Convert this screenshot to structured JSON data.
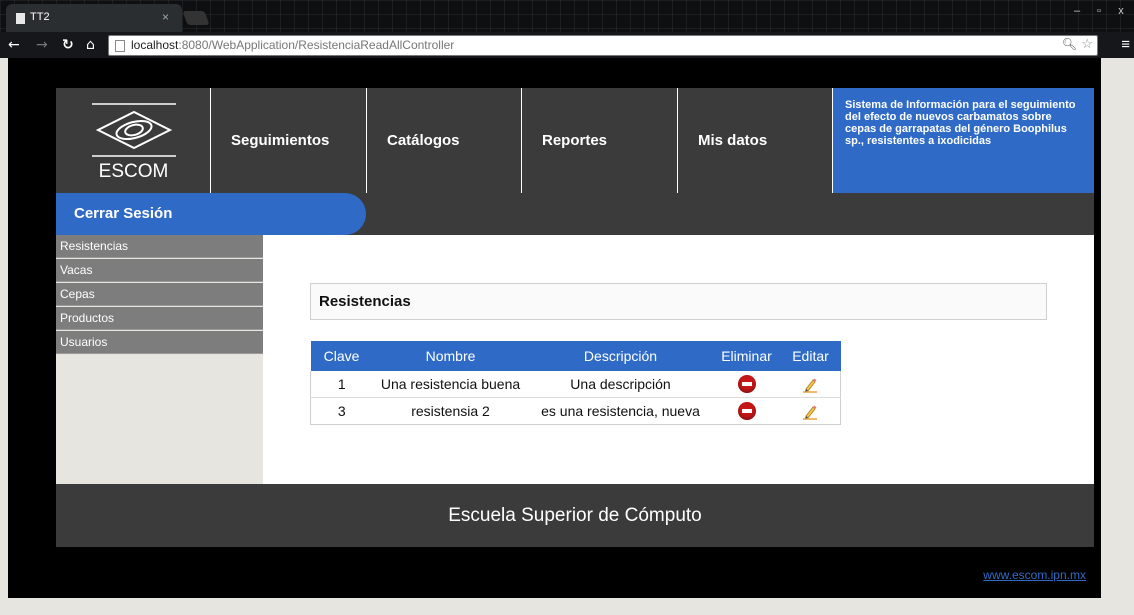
{
  "browser": {
    "tab_title": "TT2",
    "tab_close": "×",
    "url_host": "localhost",
    "url_rest": ":8080/WebApplication/ResistenciaReadAllController",
    "window_buttons": [
      "–",
      "▫",
      "x"
    ]
  },
  "header": {
    "logo_text": "ESCOM",
    "nav": [
      "Seguimientos",
      "Catálogos",
      "Reportes",
      "Mis datos"
    ],
    "system_info": "Sistema de Información para el seguimiento del efecto de nuevos carbamatos sobre cepas de garrapatas del género Boophilus sp., resistentes a ixodicidas"
  },
  "session": {
    "logout_label": "Cerrar Sesión"
  },
  "sidebar": {
    "items": [
      "Resistencias",
      "Vacas",
      "Cepas",
      "Productos",
      "Usuarios"
    ]
  },
  "main": {
    "panel_title": "Resistencias",
    "table": {
      "headers": [
        "Clave",
        "Nombre",
        "Descripción",
        "Eliminar",
        "Editar"
      ],
      "rows": [
        [
          "1",
          "Una resistencia buena",
          "Una descripción"
        ],
        [
          "3",
          "resistensia 2",
          "es una resistencia, nueva"
        ]
      ]
    }
  },
  "footer": {
    "title": "Escuela Superior de Cómputo",
    "link": "www.escom.ipn.mx"
  },
  "colors": {
    "accent": "#2f6bc6",
    "dark": "#3b3b3b",
    "sidebar": "#7d7d7d",
    "delete": "#c51717"
  }
}
